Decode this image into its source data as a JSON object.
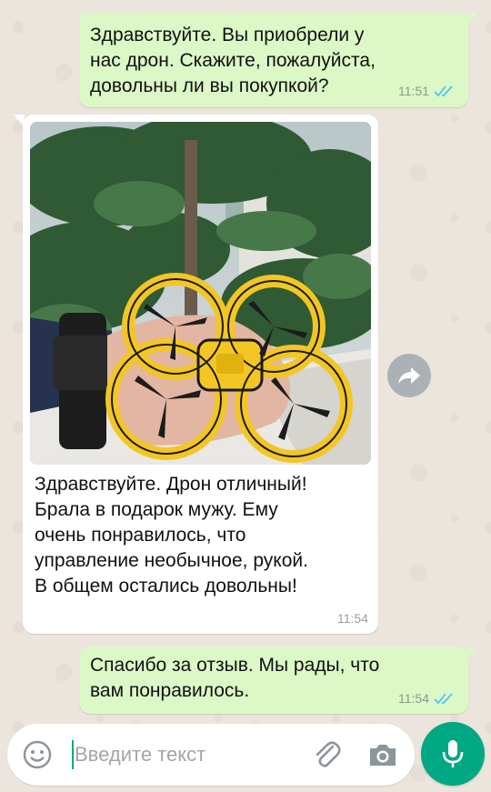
{
  "colors": {
    "outgoing_bubble": "#dcf8c6",
    "incoming_bubble": "#ffffff",
    "accent": "#00a884",
    "read_ticks": "#4fc3f7"
  },
  "messages": [
    {
      "direction": "outgoing",
      "text": "Здравствуйте. Вы приобрели у\nнас дрон. Скажите, пожалуйста,\nдовольны ли вы покупкой?",
      "time": "11:51",
      "status_icon": "double-check-read-icon"
    },
    {
      "direction": "incoming",
      "image": "yellow-drone-on-hand-photo",
      "text": "Здравствуйте. Дрон отличный!\nБрала в подарок мужу. Ему\nочень понравилось, что\nуправление необычное, рукой.\nВ общем остались довольны!",
      "time": "11:54"
    },
    {
      "direction": "outgoing",
      "text": "Спасибо за отзыв. Мы рады, что\nвам понравилось.",
      "time": "11:54",
      "status_icon": "double-check-read-icon"
    }
  ],
  "composer": {
    "placeholder": "Введите текст",
    "emoji_icon": "emoji-icon",
    "attach_icon": "paperclip-icon",
    "camera_icon": "camera-icon",
    "mic_icon": "microphone-icon"
  },
  "forward_icon": "forward-arrow-icon"
}
